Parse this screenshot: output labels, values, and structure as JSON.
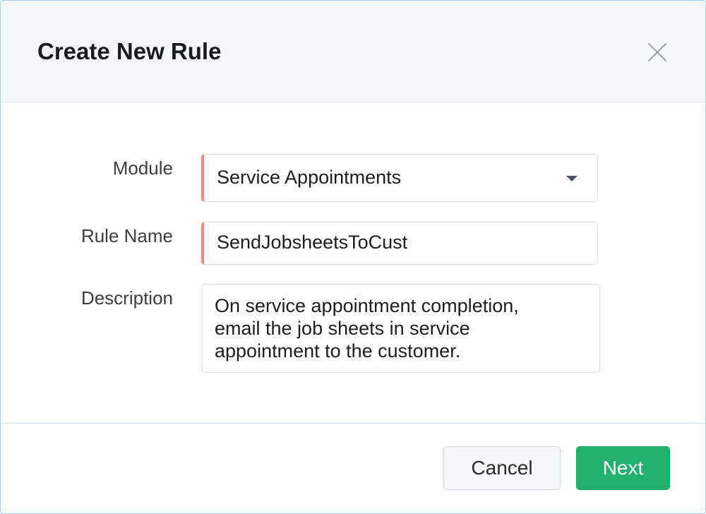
{
  "dialog": {
    "title": "Create New Rule",
    "close_icon": "close-icon"
  },
  "form": {
    "module": {
      "label": "Module",
      "value": "Service Appointments",
      "icon": "caret-down-icon"
    },
    "rule_name": {
      "label": "Rule Name",
      "value": "SendJobsheetsToCust"
    },
    "description": {
      "label": "Description",
      "value": "On service appointment completion,\nemail the job sheets in service\nappointment to the customer."
    }
  },
  "footer": {
    "cancel_label": "Cancel",
    "next_label": "Next"
  },
  "colors": {
    "header_bg": "#f3f7f9",
    "mandatory_marker": "#ef8a83",
    "primary_button": "#21b06e",
    "border": "#a9ccee"
  }
}
